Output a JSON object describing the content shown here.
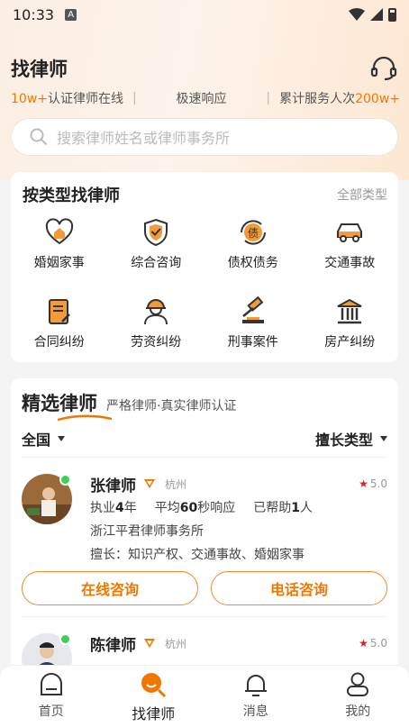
{
  "status": {
    "time": "10:33"
  },
  "header": {
    "title": "找律师"
  },
  "stats": {
    "certified_count": "10w+",
    "certified_text": "认证律师在线",
    "fast": "极速响应",
    "served_text": "累计服务人次",
    "served_count": "200w+"
  },
  "search": {
    "placeholder": "搜索律师姓名或律师事务所"
  },
  "types": {
    "title": "按类型找律师",
    "all": "全部类型",
    "items": [
      {
        "label": "婚姻家事",
        "icon": "heart-home-icon"
      },
      {
        "label": "综合咨询",
        "icon": "shield-check-icon"
      },
      {
        "label": "债权债务",
        "icon": "debt-cycle-icon"
      },
      {
        "label": "交通事故",
        "icon": "car-icon"
      },
      {
        "label": "合同纠纷",
        "icon": "contract-icon"
      },
      {
        "label": "劳资纠纷",
        "icon": "worker-icon"
      },
      {
        "label": "刑事案件",
        "icon": "gavel-icon"
      },
      {
        "label": "房产纠纷",
        "icon": "building-icon"
      }
    ]
  },
  "lawyers": {
    "title": "精选律师",
    "subtitle": "严格律师·真实律师认证",
    "filter_region": "全国",
    "filter_type": "擅长类型",
    "list": [
      {
        "name": "张律师",
        "city": "杭州",
        "rating": "5.0",
        "years_prefix": "执业",
        "years": "4",
        "years_suffix": "年",
        "resp_prefix": "平均",
        "resp": "60",
        "resp_suffix": "秒响应",
        "helped_prefix": "已帮助",
        "helped": "1",
        "helped_suffix": "人",
        "firm": "浙江平君律师事务所",
        "expertise": "擅长：知识产权、交通事故、婚姻家事",
        "btn_online": "在线咨询",
        "btn_phone": "电话咨询"
      },
      {
        "name": "陈律师",
        "city": "杭州",
        "rating": "5.0"
      }
    ]
  },
  "tabbar": {
    "items": [
      {
        "label": "首页"
      },
      {
        "label": "找律师"
      },
      {
        "label": "消息"
      },
      {
        "label": "我的"
      }
    ]
  },
  "colors": {
    "accent": "#f07800",
    "online": "#3ccf5a",
    "star": "#e02020"
  }
}
